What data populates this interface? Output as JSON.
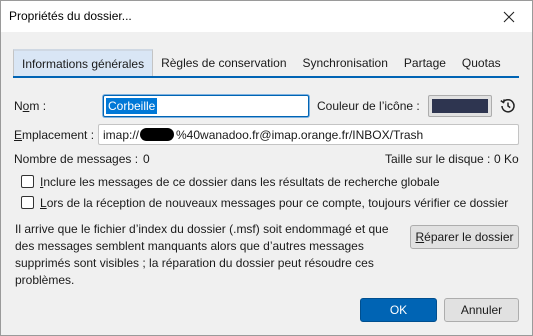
{
  "window": {
    "title": "Propriétés du dossier..."
  },
  "tabs": [
    {
      "label": "Informations générales",
      "active": true
    },
    {
      "label": "Règles de conservation",
      "active": false
    },
    {
      "label": "Synchronisation",
      "active": false
    },
    {
      "label": "Partage",
      "active": false
    },
    {
      "label": "Quotas",
      "active": false
    }
  ],
  "general": {
    "name_label_pre": "N",
    "name_label_ul": "o",
    "name_label_post": "m :",
    "name_value": "Corbeille",
    "icon_color_label": "Couleur de l’icône :",
    "icon_color": "#2e3550",
    "location_label_ul": "E",
    "location_label_post": "mplacement :",
    "location_prefix": "imap://",
    "location_suffix": "%40wanadoo.fr@imap.orange.fr/INBOX/Trash",
    "message_count_label": "Nombre de messages :",
    "message_count": "0",
    "disk_size_label": "Taille sur le disque :",
    "disk_size": "0 Ko",
    "checkbox_search_pre": "",
    "checkbox_search_ul": "I",
    "checkbox_search_post": "nclure les messages de ce dossier dans les résultats de recherche globale",
    "checkbox_search_checked": false,
    "checkbox_check_ul": "L",
    "checkbox_check_post": "ors de la réception de nouveaux messages pour ce compte, toujours vérifier ce dossier",
    "checkbox_check_checked": false,
    "info_text": "Il arrive que le fichier d’index du dossier (.msf) soit endommagé et que des messages semblent manquants alors que d’autres messages supprimés sont visibles ; la réparation du dossier peut résoudre ces problèmes.",
    "repair_label_ul": "R",
    "repair_label_post": "éparer le dossier"
  },
  "buttons": {
    "ok": "OK",
    "cancel": "Annuler"
  },
  "colors": {
    "accent": "#0064b4",
    "tab_active_bg": "#d9e6f5",
    "selection": "#0078d7"
  }
}
